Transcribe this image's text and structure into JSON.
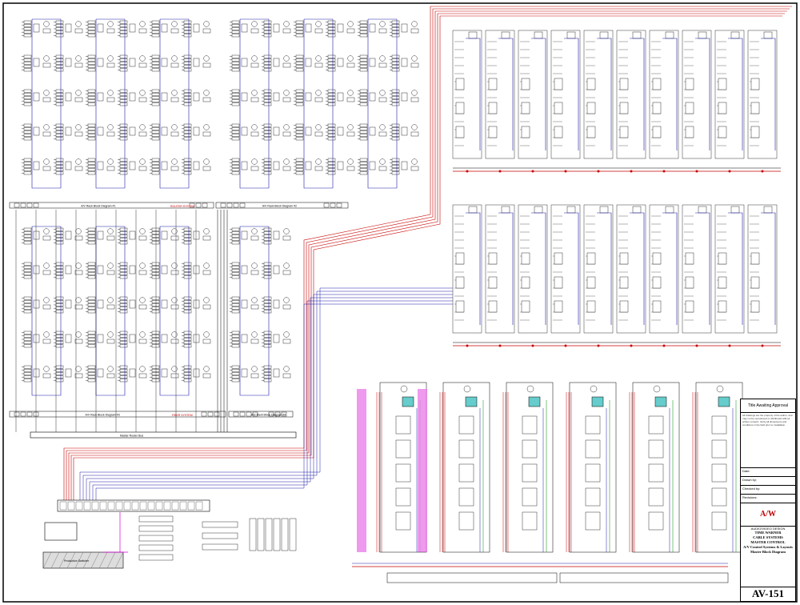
{
  "title_block": {
    "header": "Title Awaiting Approval",
    "notes": "All drawings are the property of the author, and may not be reproduced or distributed without written consent. Verify all dimensions and conditions in the field prior to installation.",
    "fields": [
      "Date:",
      "Drawn by:",
      "Checked by:",
      "Revisions:"
    ],
    "logo": "A/W",
    "company": "AUDIO/VIDEO DESIGN",
    "client_line1": "TIME WARNER",
    "client_line2": "CABLE SYSTEMS",
    "client_line3": "MASTER CONTROL",
    "system": "A/V Control Systems & Layouts",
    "drawing": "Master Block Diagram",
    "sheet_number": "AV-151"
  },
  "section_labels": {
    "group_a": "A/V Rack Block Diagram #1",
    "group_b": "A/V Rack Block Diagram #2",
    "group_c": "A/V Rack Block Diagram #3",
    "group_d": "A/V Rack Block Diagram #4",
    "red_a": "ROUTER SYSTEM",
    "red_c": "FIBER SYSTEM",
    "bus": "Master Router Bus",
    "switcher": "Production Switcher"
  },
  "colors": {
    "red": "#c80000",
    "blue": "#1a1aa8",
    "magenta": "#d400d4",
    "green": "#008800",
    "cyan": "#66cccc",
    "line": "#000000"
  }
}
